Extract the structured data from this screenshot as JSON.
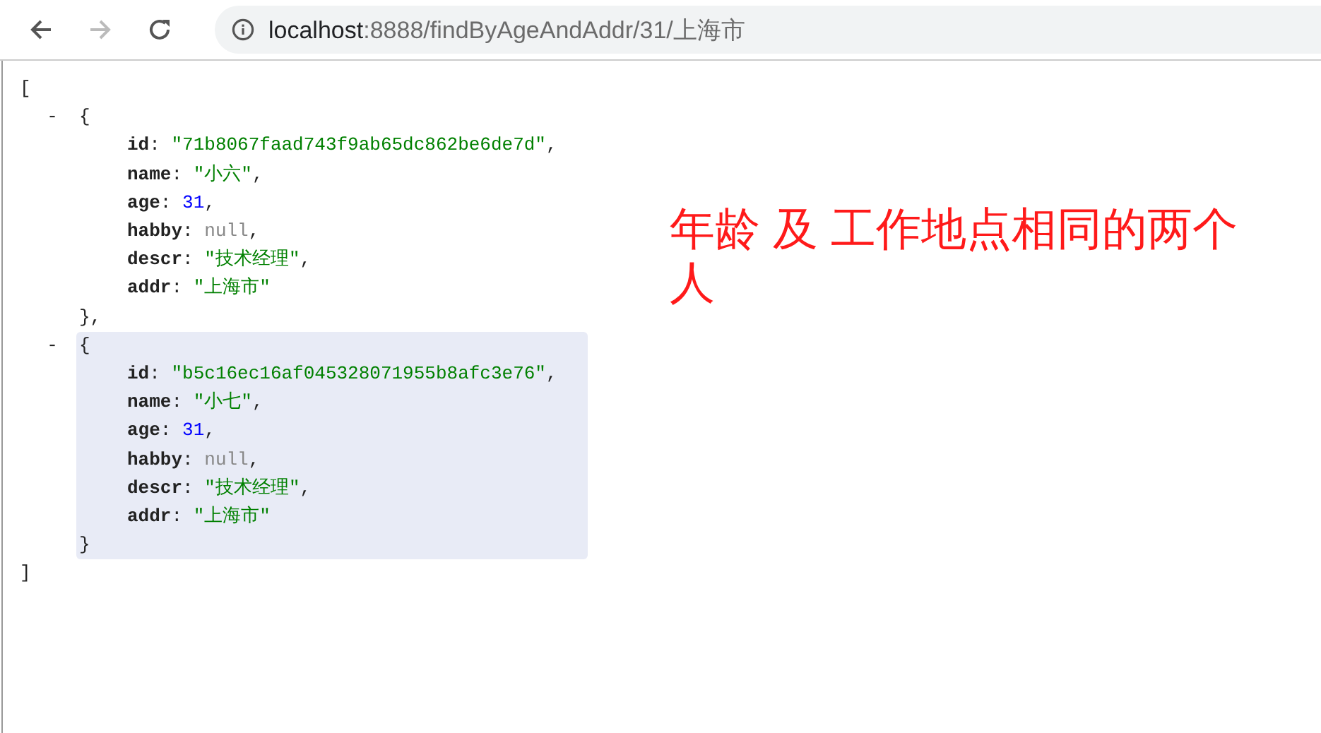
{
  "toolbar": {
    "url_host": "localhost",
    "url_path": ":8888/findByAgeAndAddr/31/上海市"
  },
  "json_view": {
    "open": "[",
    "close": "]",
    "records": [
      {
        "toggle": "-",
        "open": "{",
        "close": "},",
        "highlighted": false,
        "fields": [
          {
            "key": "id",
            "colon": ":",
            "value": "\"71b8067faad743f9ab65dc862be6de7d\"",
            "kind": "string",
            "sep": ","
          },
          {
            "key": "name",
            "colon": ":",
            "value": "\"小六\"",
            "kind": "string",
            "sep": ","
          },
          {
            "key": "age",
            "colon": ":",
            "value": "31",
            "kind": "number",
            "sep": ","
          },
          {
            "key": "habby",
            "colon": ":",
            "value": "null",
            "kind": "null",
            "sep": ","
          },
          {
            "key": "descr",
            "colon": ":",
            "value": "\"技术经理\"",
            "kind": "string",
            "sep": ","
          },
          {
            "key": "addr",
            "colon": ":",
            "value": "\"上海市\"",
            "kind": "string"
          }
        ]
      },
      {
        "toggle": "-",
        "open": "{",
        "close": "}",
        "highlighted": true,
        "fields": [
          {
            "key": "id",
            "colon": ":",
            "value": "\"b5c16ec16af045328071955b8afc3e76\"",
            "kind": "string",
            "sep": ","
          },
          {
            "key": "name",
            "colon": ":",
            "value": "\"小七\"",
            "kind": "string",
            "sep": ","
          },
          {
            "key": "age",
            "colon": ":",
            "value": "31",
            "kind": "number",
            "sep": ","
          },
          {
            "key": "habby",
            "colon": ":",
            "value": "null",
            "kind": "null",
            "sep": ","
          },
          {
            "key": "descr",
            "colon": ":",
            "value": "\"技术经理\"",
            "kind": "string",
            "sep": ","
          },
          {
            "key": "addr",
            "colon": ":",
            "value": "\"上海市\"",
            "kind": "string"
          }
        ]
      }
    ]
  },
  "annotation": "年龄 及 工作地点相同的两个人"
}
